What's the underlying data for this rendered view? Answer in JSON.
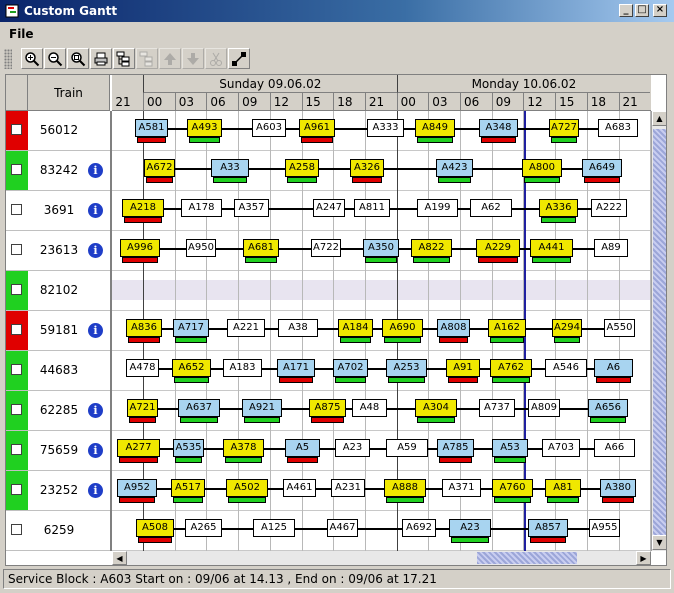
{
  "window": {
    "title": "Custom Gantt"
  },
  "menu": {
    "file": "File"
  },
  "toolbar": {
    "buttons": [
      "zoom-in-icon",
      "zoom-out-icon",
      "zoom-fit-icon",
      "print-icon",
      "hierarchy-icon",
      "hierarchy-disabled-icon",
      "move-up-icon",
      "move-down-icon",
      "cut-icon",
      "connect-icon"
    ]
  },
  "header": {
    "train_label": "Train"
  },
  "timescale": {
    "days": [
      "Sunday 09.06.02",
      "Monday 10.06.02"
    ],
    "hours": [
      "21",
      "00",
      "03",
      "06",
      "09",
      "12",
      "15",
      "18",
      "21",
      "00",
      "03",
      "06",
      "09",
      "12",
      "15",
      "18",
      "21"
    ]
  },
  "colors": {
    "yellow": "#f0e800",
    "blue": "#a8d4f0",
    "white": "#ffffff",
    "red": "#e00000",
    "green": "#20d020"
  },
  "rows": [
    {
      "train": "56012",
      "status": "red",
      "info": false,
      "blocks": [
        [
          "A581",
          "blue"
        ],
        [
          "A493",
          "yellow"
        ],
        [
          "A603",
          "white"
        ],
        [
          "A961",
          "yellow"
        ],
        [
          "A333",
          "white"
        ],
        [
          "A849",
          "yellow"
        ],
        [
          "A348",
          "blue"
        ],
        [
          "A727",
          "yellow"
        ],
        [
          "A683",
          "white"
        ]
      ]
    },
    {
      "train": "83242",
      "status": "green",
      "info": true,
      "blocks": [
        [
          "A672",
          "yellow"
        ],
        [
          "A33",
          "blue"
        ],
        [
          "A258",
          "yellow"
        ],
        [
          "A326",
          "yellow"
        ],
        [
          "A423",
          "blue"
        ],
        [
          "A800",
          "yellow"
        ],
        [
          "A649",
          "blue"
        ]
      ]
    },
    {
      "train": "3691",
      "status": "none",
      "info": true,
      "blocks": [
        [
          "A218",
          "yellow"
        ],
        [
          "A178",
          "white"
        ],
        [
          "A357",
          "white"
        ],
        [
          "A247",
          "white"
        ],
        [
          "A811",
          "white"
        ],
        [
          "A199",
          "white"
        ],
        [
          "A62",
          "white"
        ],
        [
          "A336",
          "yellow"
        ],
        [
          "A222",
          "white"
        ]
      ]
    },
    {
      "train": "23613",
      "status": "none",
      "info": true,
      "blocks": [
        [
          "A996",
          "yellow"
        ],
        [
          "A950",
          "white"
        ],
        [
          "A681",
          "yellow"
        ],
        [
          "A722",
          "white"
        ],
        [
          "A350",
          "blue"
        ],
        [
          "A822",
          "yellow"
        ],
        [
          "A229",
          "yellow"
        ],
        [
          "A441",
          "yellow"
        ],
        [
          "A89",
          "white"
        ]
      ]
    },
    {
      "train": "82102",
      "status": "green",
      "info": false,
      "blocks": []
    },
    {
      "train": "59181",
      "status": "red",
      "info": true,
      "blocks": [
        [
          "A836",
          "yellow"
        ],
        [
          "A717",
          "blue"
        ],
        [
          "A221",
          "white"
        ],
        [
          "A38",
          "white"
        ],
        [
          "A184",
          "yellow"
        ],
        [
          "A690",
          "yellow"
        ],
        [
          "A808",
          "blue"
        ],
        [
          "A162",
          "yellow"
        ],
        [
          "A294",
          "yellow"
        ],
        [
          "A550",
          "white"
        ]
      ]
    },
    {
      "train": "44683",
      "status": "green",
      "info": false,
      "blocks": [
        [
          "A478",
          "white"
        ],
        [
          "A652",
          "yellow"
        ],
        [
          "A183",
          "white"
        ],
        [
          "A171",
          "blue"
        ],
        [
          "A702",
          "blue"
        ],
        [
          "A253",
          "blue"
        ],
        [
          "A91",
          "yellow"
        ],
        [
          "A762",
          "yellow"
        ],
        [
          "A546",
          "white"
        ],
        [
          "A6",
          "blue"
        ]
      ]
    },
    {
      "train": "62285",
      "status": "green",
      "info": true,
      "blocks": [
        [
          "A721",
          "yellow"
        ],
        [
          "A637",
          "blue"
        ],
        [
          "A921",
          "blue"
        ],
        [
          "A875",
          "yellow"
        ],
        [
          "A48",
          "white"
        ],
        [
          "A304",
          "yellow"
        ],
        [
          "A737",
          "white"
        ],
        [
          "A809",
          "white"
        ],
        [
          "A656",
          "blue"
        ]
      ]
    },
    {
      "train": "75659",
      "status": "green",
      "info": true,
      "blocks": [
        [
          "A277",
          "yellow"
        ],
        [
          "A535",
          "blue"
        ],
        [
          "A378",
          "yellow"
        ],
        [
          "A5",
          "blue"
        ],
        [
          "A23",
          "white"
        ],
        [
          "A59",
          "white"
        ],
        [
          "A785",
          "blue"
        ],
        [
          "A53",
          "blue"
        ],
        [
          "A703",
          "white"
        ],
        [
          "A66",
          "white"
        ]
      ]
    },
    {
      "train": "23252",
      "status": "green",
      "info": true,
      "blocks": [
        [
          "A952",
          "blue"
        ],
        [
          "A517",
          "yellow"
        ],
        [
          "A502",
          "yellow"
        ],
        [
          "A461",
          "white"
        ],
        [
          "A231",
          "white"
        ],
        [
          "A888",
          "yellow"
        ],
        [
          "A371",
          "white"
        ],
        [
          "A760",
          "yellow"
        ],
        [
          "A81",
          "yellow"
        ],
        [
          "A380",
          "blue"
        ]
      ]
    },
    {
      "train": "6259",
      "status": "none",
      "info": false,
      "blocks": [
        [
          "A508",
          "yellow"
        ],
        [
          "A265",
          "white"
        ],
        [
          "A125",
          "white"
        ],
        [
          "A467",
          "white"
        ],
        [
          "A692",
          "white"
        ],
        [
          "A23",
          "blue"
        ],
        [
          "A857",
          "blue"
        ],
        [
          "A955",
          "white"
        ]
      ]
    }
  ],
  "status_bar": {
    "text": "Service Block : A603  Start on : 09/06 at 14.13 , End on : 09/06 at 17.21"
  }
}
